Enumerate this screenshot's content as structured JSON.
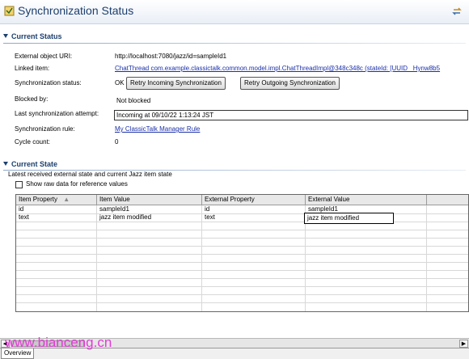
{
  "header": {
    "title": "Synchronization Status"
  },
  "current_status": {
    "heading": "Current Status",
    "external_uri_label": "External object URI:",
    "external_uri_value": "http://localhost:7080/jazz/id=sampleId1",
    "linked_item_label": "Linked item:",
    "linked_item_value": "ChatThread com.example.classictalk.common.model.impl.ChatThreadImpl@348c348c (stateId: [UUID _Hynw8b5",
    "sync_status_label": "Synchronization status:",
    "sync_status_value": "OK",
    "retry_incoming_label": "Retry Incoming Synchronization",
    "retry_outgoing_label": "Retry Outgoing Synchronization",
    "blocked_by_label": "Blocked by:",
    "blocked_by_value": "Not blocked",
    "last_attempt_label": "Last synchronization attempt:",
    "last_attempt_value": "Incoming at 09/10/22 1:13:24 JST",
    "sync_rule_label": "Synchronization rule:",
    "sync_rule_value": "My ClassicTalk Manager Rule",
    "cycle_count_label": "Cycle count:",
    "cycle_count_value": "0"
  },
  "current_state": {
    "heading": "Current State",
    "description": "Latest received external state and current Jazz item state",
    "show_raw_label": "Show raw data for reference values",
    "columns": [
      "Item Property",
      "Item Value",
      "External Property",
      "External Value"
    ],
    "rows": [
      [
        "id",
        "sampleId1",
        "id",
        "sampleId1"
      ],
      [
        "text",
        "jazz item modified",
        "text",
        "jazz item modified"
      ]
    ]
  },
  "footer": {
    "tab_overview": "Overview",
    "watermark": "www.bianceng.cn"
  },
  "colors": {
    "title_blue": "#1c3f6e",
    "link_blue": "#1a2fa8",
    "watermark_magenta": "#e23bd6"
  }
}
